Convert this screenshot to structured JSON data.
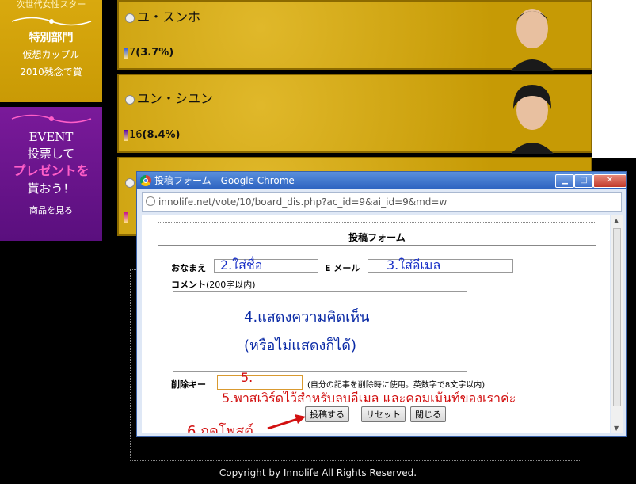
{
  "left_panel": {
    "gold": {
      "top_text": "次世代女性スター",
      "line1": "特別部門",
      "line2": "仮想カップル",
      "line3": "2010残念で賞"
    },
    "purple": {
      "line1": "EVENT",
      "line2": "投票して",
      "line3": "プレゼントを",
      "line4": "貰おう！",
      "link": "商品を見る"
    }
  },
  "candidates": [
    {
      "name": "ユ・スンホ",
      "votes": "7",
      "percent": "(3.7%)"
    },
    {
      "name": "ユン・シユン",
      "votes": "16",
      "percent": "(8.4%)"
    }
  ],
  "footer": {
    "copyright": "Copyright by Innolife All Rights Reserved."
  },
  "popup": {
    "title": "投稿フォーム - Google Chrome",
    "url": "innolife.net/vote/10/board_dis.php?ac_id=9&ai_id=9&md=w",
    "form_title": "投稿フォーム",
    "name_label": "おなまえ",
    "name_value": "2.ใส่ชื่อ",
    "email_label": "E メール",
    "email_value": "3.ใส่อีเมล",
    "comment_label": "コメント",
    "comment_hint": "(200字以内)",
    "comment_text1": "4.แสดงความคิดเห็น",
    "comment_text2": "(หรือไม่แสดงก็ได้)",
    "delete_key_label": "削除キー",
    "delete_key_value": "5.",
    "delete_key_hint": "(自分の記事を削除時に使用。英数字で8文字以内)",
    "annotation_password": "5.พาสเวิร์ดไว้สำหรับลบอีเมล และคอมเม้นท์ของเราค่ะ",
    "annotation_post": "6.กดโพสต์",
    "buttons": {
      "post": "投稿する",
      "reset": "リセット",
      "close": "閉じる"
    }
  },
  "colors": {
    "gold": "#c99a05",
    "purple": "#5a0f7e",
    "titlebar": "#2c62c0",
    "annotation_blue": "#1c33c8",
    "annotation_red": "#d21010"
  }
}
